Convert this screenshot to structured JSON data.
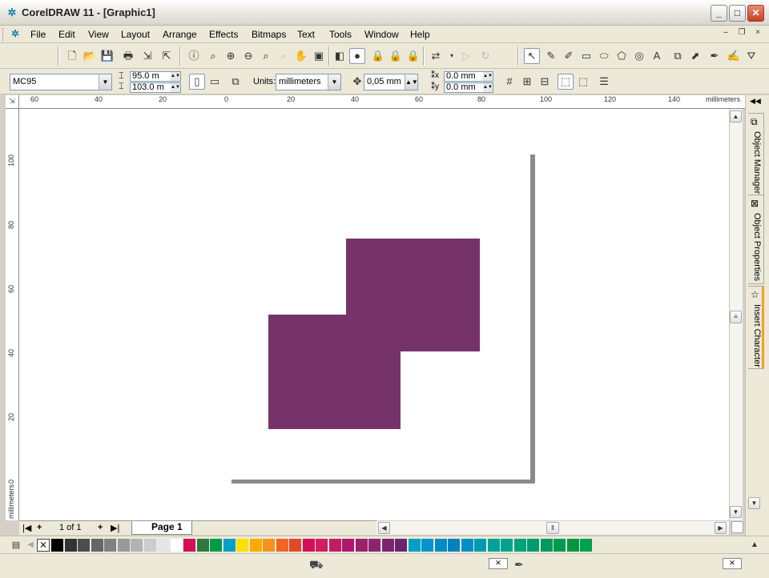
{
  "window": {
    "title": "CorelDRAW 11 - [Graphic1]",
    "app_icon": "coreldraw-balloon-icon",
    "minimize": "_",
    "maximize": "□",
    "close": "✕"
  },
  "menu": {
    "items": [
      "File",
      "Edit",
      "View",
      "Layout",
      "Arrange",
      "Effects",
      "Bitmaps",
      "Text",
      "Tools",
      "Window",
      "Help"
    ],
    "mdi_minimize": "–",
    "mdi_restore": "❐",
    "mdi_close": "×"
  },
  "toolbar": {
    "icons": [
      "new-icon",
      "open-icon",
      "save-icon",
      "print-icon",
      "import-icon",
      "export-icon",
      "info-icon",
      "zoom-icon",
      "zoom-in-icon",
      "zoom-out-icon",
      "zoom-fit-icon",
      "zoom-page-icon",
      "pan-icon",
      "view-manager-icon",
      "shape-icon",
      "color-icon",
      "lock-icon",
      "unlock-icon",
      "lock2-icon",
      "transform-icon",
      "play-icon",
      "redo-icon",
      "pick-tool-icon",
      "shape-tool-icon",
      "freehand-icon",
      "rectangle-icon",
      "ellipse-icon",
      "polygon-icon",
      "spiral-icon",
      "text-tool-icon",
      "interactive-icon",
      "eyedropper-icon",
      "outline-icon",
      "fill-icon"
    ]
  },
  "property_bar": {
    "paper_size": "MC95",
    "width": "95.0 m",
    "height": "103.0 m",
    "units_label": "Units:",
    "units_value": "millimeters",
    "nudge": "0,05 mm",
    "dup_x": "0.0 mm",
    "dup_y": "0.0 mm"
  },
  "rulers": {
    "units": "millimeters",
    "horizontal_ticks": [
      "60",
      "40",
      "20",
      "0",
      "20",
      "40",
      "60",
      "80",
      "100",
      "120",
      "140"
    ],
    "vertical_ticks": [
      "100",
      "80",
      "60",
      "40",
      "20",
      "0"
    ],
    "vertical_units": "millimeters"
  },
  "page_nav": {
    "page_count": "1 of 1",
    "page_tab": "Page 1",
    "first": "|◀",
    "add": "+",
    "add_after": "+",
    "last": "▶|"
  },
  "dockers": {
    "tabs": [
      "Object Manager",
      "Object Properties",
      "Insert Character"
    ],
    "collapse": "◀◀"
  },
  "drawing": {
    "fill_color": "#76336a",
    "shadow_color": "#8a8a8a"
  },
  "palette": {
    "colors": [
      "#000000",
      "#333333",
      "#4d4d4d",
      "#666666",
      "#808080",
      "#999999",
      "#b3b3b3",
      "#cccccc",
      "#e6e6e6",
      "#ffffff",
      "#d40f5a",
      "#2e7a3e",
      "#009b48",
      "#00a0c6",
      "#ffdf00",
      "#ffaa00",
      "#f6921e",
      "#f26522",
      "#e24827",
      "#d40f5a",
      "#d11f5d",
      "#c11b62",
      "#b0176a",
      "#9e1f6d",
      "#8c2471",
      "#7b2470",
      "#6a246d",
      "#00a0c6",
      "#0095c8",
      "#008cc4",
      "#0081c0",
      "#0090c6",
      "#009aaa",
      "#00a29a",
      "#00a38b",
      "#00a17d",
      "#009b6f",
      "#009a5e",
      "#009a4c",
      "#00983f",
      "#00a04d"
    ]
  }
}
